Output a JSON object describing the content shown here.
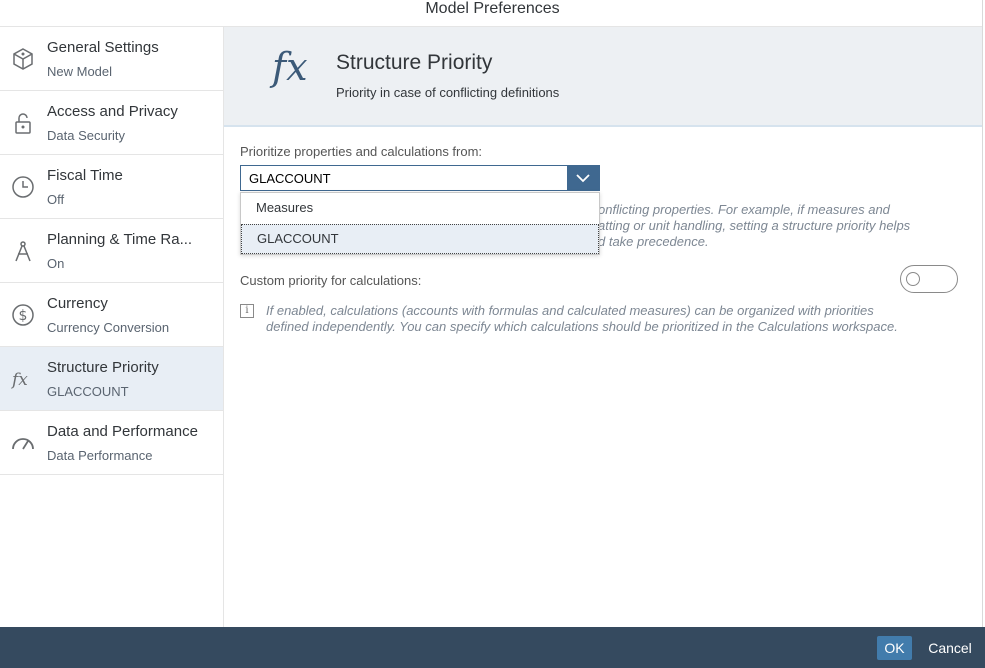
{
  "dialog": {
    "title": "Model Preferences"
  },
  "sidebar": {
    "items": [
      {
        "title": "General Settings",
        "sub": "New Model",
        "icon": "cube-icon"
      },
      {
        "title": "Access and Privacy",
        "sub": "Data Security",
        "icon": "unlock-icon"
      },
      {
        "title": "Fiscal Time",
        "sub": "Off",
        "icon": "clock-icon"
      },
      {
        "title": "Planning & Time Ra...",
        "sub": "On",
        "icon": "compass-icon"
      },
      {
        "title": "Currency",
        "sub": "Currency Conversion",
        "icon": "dollar-icon"
      },
      {
        "title": "Structure Priority",
        "sub": "GLACCOUNT",
        "icon": "fx-icon",
        "selected": true
      },
      {
        "title": "Data and Performance",
        "sub": "Data Performance",
        "icon": "gauge-icon"
      }
    ]
  },
  "main": {
    "header_icon": "fx",
    "title": "Structure Priority",
    "subtitle": "Priority in case of conflicting definitions",
    "prioritize_label": "Prioritize properties and calculations from:",
    "select_value": "GLACCOUNT",
    "dropdown_options": [
      "Measures",
      "GLACCOUNT"
    ],
    "description_lines": [
      "onflicting properties. For example, if measures and",
      "atting or unit handling, setting a structure priority helps",
      "d take precedence."
    ],
    "custom_label": "Custom priority for calculations:",
    "custom_toggle_on": false,
    "info_lines": [
      "If enabled, calculations (accounts with formulas and calculated measures) can be organized with priorities",
      "defined independently. You can specify which calculations should be prioritized in the Calculations workspace."
    ]
  },
  "footer": {
    "ok_label": "OK",
    "cancel_label": "Cancel"
  },
  "colors": {
    "accent": "#427cac",
    "footer": "#354a5f",
    "selected_bg": "#e8eef5"
  }
}
